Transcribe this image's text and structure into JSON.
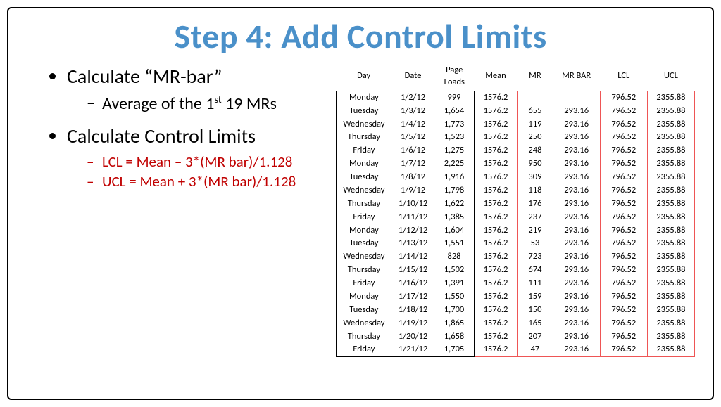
{
  "title": "Step 4: Add Control Limits",
  "bullets": {
    "b1": "Calculate “MR-bar”",
    "b1_sub1_html": "Average of the 1<sup>st</sup> 19 MRs",
    "b2": "Calculate Control Limits",
    "b2_sub1": "LCL = Mean – 3*(MR bar)/1.128",
    "b2_sub2": "UCL = Mean + 3*(MR bar)/1.128"
  },
  "table": {
    "headers": {
      "day": "Day",
      "date": "Date",
      "loads_line1": "Page",
      "loads_line2": "Loads",
      "mean": "Mean",
      "mr": "MR",
      "mrbar": "MR BAR",
      "lcl": "LCL",
      "ucl": "UCL"
    },
    "rows": [
      {
        "day": "Monday",
        "date": "1/2/12",
        "loads": "999",
        "mean": "1576.2",
        "mr": "",
        "mrbar": "",
        "lcl": "796.52",
        "ucl": "2355.88"
      },
      {
        "day": "Tuesday",
        "date": "1/3/12",
        "loads": "1,654",
        "mean": "1576.2",
        "mr": "655",
        "mrbar": "293.16",
        "lcl": "796.52",
        "ucl": "2355.88"
      },
      {
        "day": "Wednesday",
        "date": "1/4/12",
        "loads": "1,773",
        "mean": "1576.2",
        "mr": "119",
        "mrbar": "293.16",
        "lcl": "796.52",
        "ucl": "2355.88"
      },
      {
        "day": "Thursday",
        "date": "1/5/12",
        "loads": "1,523",
        "mean": "1576.2",
        "mr": "250",
        "mrbar": "293.16",
        "lcl": "796.52",
        "ucl": "2355.88"
      },
      {
        "day": "Friday",
        "date": "1/6/12",
        "loads": "1,275",
        "mean": "1576.2",
        "mr": "248",
        "mrbar": "293.16",
        "lcl": "796.52",
        "ucl": "2355.88"
      },
      {
        "day": "Monday",
        "date": "1/7/12",
        "loads": "2,225",
        "mean": "1576.2",
        "mr": "950",
        "mrbar": "293.16",
        "lcl": "796.52",
        "ucl": "2355.88"
      },
      {
        "day": "Tuesday",
        "date": "1/8/12",
        "loads": "1,916",
        "mean": "1576.2",
        "mr": "309",
        "mrbar": "293.16",
        "lcl": "796.52",
        "ucl": "2355.88"
      },
      {
        "day": "Wednesday",
        "date": "1/9/12",
        "loads": "1,798",
        "mean": "1576.2",
        "mr": "118",
        "mrbar": "293.16",
        "lcl": "796.52",
        "ucl": "2355.88"
      },
      {
        "day": "Thursday",
        "date": "1/10/12",
        "loads": "1,622",
        "mean": "1576.2",
        "mr": "176",
        "mrbar": "293.16",
        "lcl": "796.52",
        "ucl": "2355.88"
      },
      {
        "day": "Friday",
        "date": "1/11/12",
        "loads": "1,385",
        "mean": "1576.2",
        "mr": "237",
        "mrbar": "293.16",
        "lcl": "796.52",
        "ucl": "2355.88"
      },
      {
        "day": "Monday",
        "date": "1/12/12",
        "loads": "1,604",
        "mean": "1576.2",
        "mr": "219",
        "mrbar": "293.16",
        "lcl": "796.52",
        "ucl": "2355.88"
      },
      {
        "day": "Tuesday",
        "date": "1/13/12",
        "loads": "1,551",
        "mean": "1576.2",
        "mr": "53",
        "mrbar": "293.16",
        "lcl": "796.52",
        "ucl": "2355.88"
      },
      {
        "day": "Wednesday",
        "date": "1/14/12",
        "loads": "828",
        "mean": "1576.2",
        "mr": "723",
        "mrbar": "293.16",
        "lcl": "796.52",
        "ucl": "2355.88"
      },
      {
        "day": "Thursday",
        "date": "1/15/12",
        "loads": "1,502",
        "mean": "1576.2",
        "mr": "674",
        "mrbar": "293.16",
        "lcl": "796.52",
        "ucl": "2355.88"
      },
      {
        "day": "Friday",
        "date": "1/16/12",
        "loads": "1,391",
        "mean": "1576.2",
        "mr": "111",
        "mrbar": "293.16",
        "lcl": "796.52",
        "ucl": "2355.88"
      },
      {
        "day": "Monday",
        "date": "1/17/12",
        "loads": "1,550",
        "mean": "1576.2",
        "mr": "159",
        "mrbar": "293.16",
        "lcl": "796.52",
        "ucl": "2355.88"
      },
      {
        "day": "Tuesday",
        "date": "1/18/12",
        "loads": "1,700",
        "mean": "1576.2",
        "mr": "150",
        "mrbar": "293.16",
        "lcl": "796.52",
        "ucl": "2355.88"
      },
      {
        "day": "Wednesday",
        "date": "1/19/12",
        "loads": "1,865",
        "mean": "1576.2",
        "mr": "165",
        "mrbar": "293.16",
        "lcl": "796.52",
        "ucl": "2355.88"
      },
      {
        "day": "Thursday",
        "date": "1/20/12",
        "loads": "1,658",
        "mean": "1576.2",
        "mr": "207",
        "mrbar": "293.16",
        "lcl": "796.52",
        "ucl": "2355.88"
      },
      {
        "day": "Friday",
        "date": "1/21/12",
        "loads": "1,705",
        "mean": "1576.2",
        "mr": "47",
        "mrbar": "293.16",
        "lcl": "796.52",
        "ucl": "2355.88"
      }
    ]
  }
}
